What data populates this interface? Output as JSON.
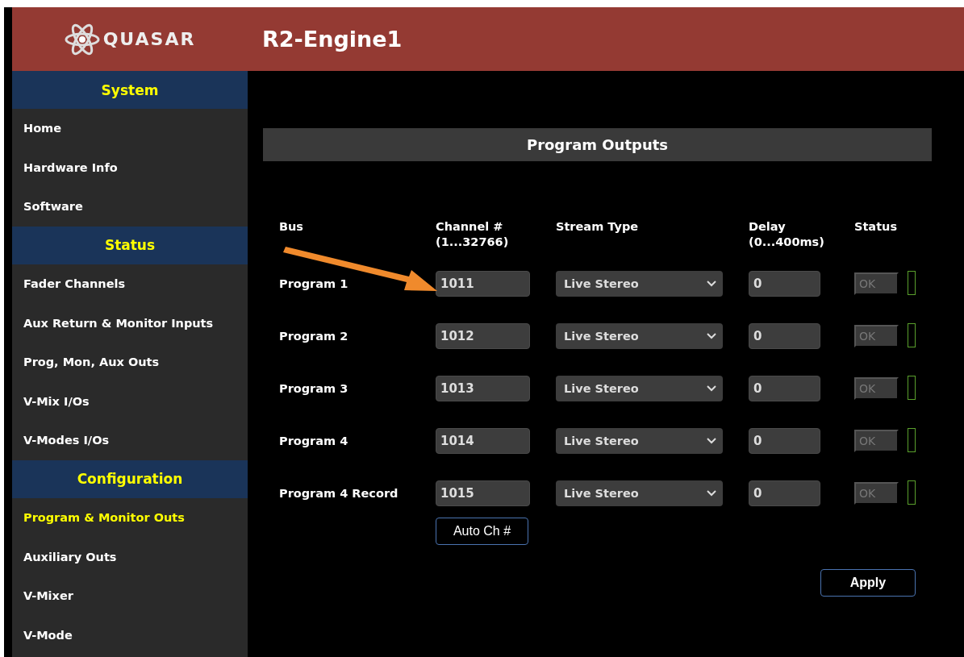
{
  "header": {
    "logo": "QUASAR",
    "title": "R2-Engine1"
  },
  "sidebar": {
    "sections": [
      {
        "heading": "System",
        "items": [
          {
            "label": "Home",
            "selected": false
          },
          {
            "label": "Hardware Info",
            "selected": false
          },
          {
            "label": "Software",
            "selected": false
          }
        ]
      },
      {
        "heading": "Status",
        "items": [
          {
            "label": "Fader Channels",
            "selected": false
          },
          {
            "label": "Aux Return & Monitor Inputs",
            "selected": false
          },
          {
            "label": "Prog, Mon, Aux Outs",
            "selected": false
          },
          {
            "label": "V-Mix I/Os",
            "selected": false
          },
          {
            "label": "V-Modes I/Os",
            "selected": false
          }
        ]
      },
      {
        "heading": "Configuration",
        "items": [
          {
            "label": "Program & Monitor Outs",
            "selected": true
          },
          {
            "label": "Auxiliary Outs",
            "selected": false
          },
          {
            "label": "V-Mixer",
            "selected": false
          },
          {
            "label": "V-Mode",
            "selected": false
          }
        ]
      }
    ]
  },
  "panel": {
    "title": "Program Outputs",
    "columns": [
      {
        "label": "Bus"
      },
      {
        "label": "Channel #",
        "sub": "(1...32766)"
      },
      {
        "label": "Stream Type"
      },
      {
        "label": "Delay",
        "sub": "(0...400ms)"
      },
      {
        "label": "Status"
      }
    ],
    "rows": [
      {
        "bus": "Program 1",
        "channel": "1011",
        "stream_type": "Live Stereo",
        "delay": "0",
        "status": "OK",
        "status_disabled": true
      },
      {
        "bus": "Program 2",
        "channel": "1012",
        "stream_type": "Live Stereo",
        "delay": "0",
        "status": "OK",
        "status_disabled": true
      },
      {
        "bus": "Program 3",
        "channel": "1013",
        "stream_type": "Live Stereo",
        "delay": "0",
        "status": "OK",
        "status_disabled": true
      },
      {
        "bus": "Program 4",
        "channel": "1014",
        "stream_type": "Live Stereo",
        "delay": "0",
        "status": "OK",
        "status_disabled": true
      },
      {
        "bus": "Program 4 Record",
        "channel": "1015",
        "stream_type": "Live Stereo",
        "delay": "0",
        "status": "OK",
        "status_disabled": true
      }
    ],
    "auto_button": "Auto Ch #",
    "apply_button": "Apply"
  }
}
